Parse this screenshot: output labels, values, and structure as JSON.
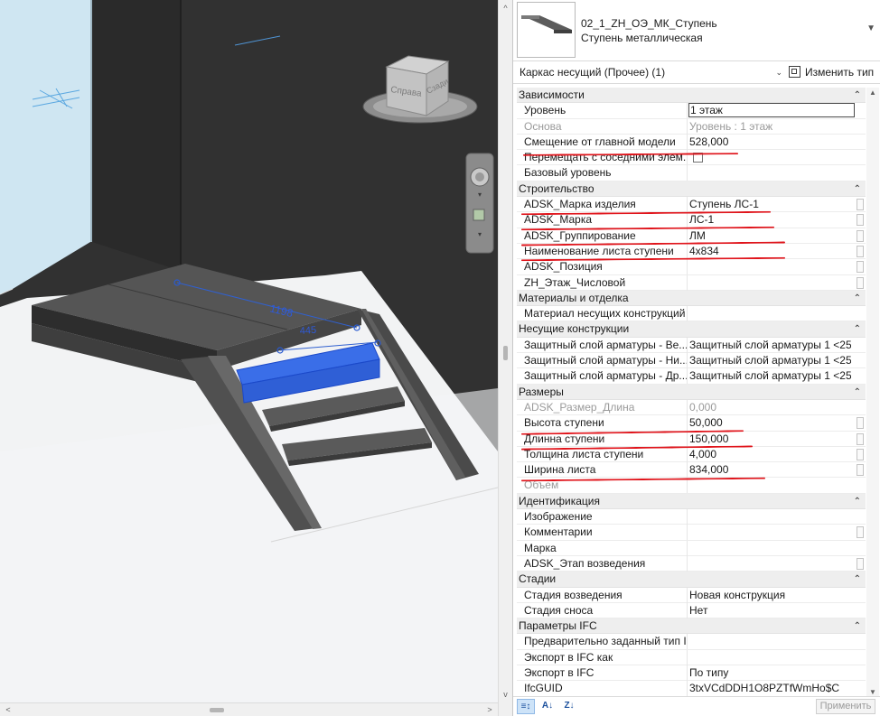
{
  "viewport": {
    "view_cube_faces": [
      "Справа",
      "Сзади"
    ],
    "dimension_1198": "1198",
    "dimension_445": "445"
  },
  "type_selector": {
    "family_name": "02_1_ZH_ОЭ_МК_Ступень",
    "type_name": "Ступень металлическая"
  },
  "filter": {
    "selected": "Каркас несущий (Прочее) (1)",
    "edit_type_label": "Изменить тип"
  },
  "groups": [
    {
      "name": "Зависимости",
      "rows": [
        {
          "name": "Уровень",
          "value": "1 этаж",
          "style": "boxed"
        },
        {
          "name": "Основа",
          "value": "Уровень : 1 этаж",
          "style": "grey"
        },
        {
          "name": "Смещение от главной модели",
          "value": "528,000"
        },
        {
          "name": "Перемещать с соседними элем...",
          "value": "",
          "style": "checkbox"
        },
        {
          "name": "Базовый уровень",
          "value": ""
        }
      ]
    },
    {
      "name": "Строительство",
      "rows": [
        {
          "name": "ADSK_Марка изделия",
          "value": "Ступень ЛС-1",
          "side": true
        },
        {
          "name": "ADSK_Марка",
          "value": "ЛС-1",
          "side": true
        },
        {
          "name": "ADSK_Группирование",
          "value": "ЛМ",
          "side": true
        },
        {
          "name": "Наименование листа ступени",
          "value": "4x834",
          "side": true
        },
        {
          "name": "ADSK_Позиция",
          "value": "",
          "side": true
        },
        {
          "name": "ZH_Этаж_Числовой",
          "value": "",
          "side": true
        }
      ]
    },
    {
      "name": "Материалы и отделка",
      "rows": [
        {
          "name": "Материал несущих конструкций",
          "value": ""
        }
      ]
    },
    {
      "name": "Несущие конструкции",
      "rows": [
        {
          "name": "Защитный слой арматуры - Ве...",
          "value": "Защитный слой арматуры 1 <25..."
        },
        {
          "name": "Защитный слой арматуры - Ни...",
          "value": "Защитный слой арматуры 1 <25..."
        },
        {
          "name": "Защитный слой арматуры - Др...",
          "value": "Защитный слой арматуры 1 <25..."
        }
      ]
    },
    {
      "name": "Размеры",
      "rows": [
        {
          "name": "ADSK_Размер_Длина",
          "value": "0,000",
          "style": "grey"
        },
        {
          "name": "Высота ступени",
          "value": "50,000",
          "side": true
        },
        {
          "name": "Длинна ступени",
          "value": "150,000",
          "side": true
        },
        {
          "name": "Толщина листа ступени",
          "value": "4,000",
          "side": true
        },
        {
          "name": "Ширина листа",
          "value": "834,000",
          "side": true
        },
        {
          "name": "Объем",
          "value": "",
          "style": "grey"
        }
      ]
    },
    {
      "name": "Идентификация",
      "rows": [
        {
          "name": "Изображение",
          "value": ""
        },
        {
          "name": "Комментарии",
          "value": "",
          "side": true
        },
        {
          "name": "Марка",
          "value": ""
        },
        {
          "name": "ADSK_Этап возведения",
          "value": "",
          "side": true
        }
      ]
    },
    {
      "name": "Стадии",
      "rows": [
        {
          "name": "Стадия возведения",
          "value": "Новая конструкция"
        },
        {
          "name": "Стадия сноса",
          "value": "Нет"
        }
      ]
    },
    {
      "name": "Параметры IFC",
      "rows": [
        {
          "name": "Предварительно заданный тип I...",
          "value": ""
        },
        {
          "name": "Экспорт в IFC как",
          "value": ""
        },
        {
          "name": "Экспорт в IFC",
          "value": "По типу"
        },
        {
          "name": "IfcGUID",
          "value": "3txVCdDDH1O8PZTfWmHo$C"
        }
      ]
    }
  ],
  "bottom": {
    "apply_label": "Применить"
  }
}
